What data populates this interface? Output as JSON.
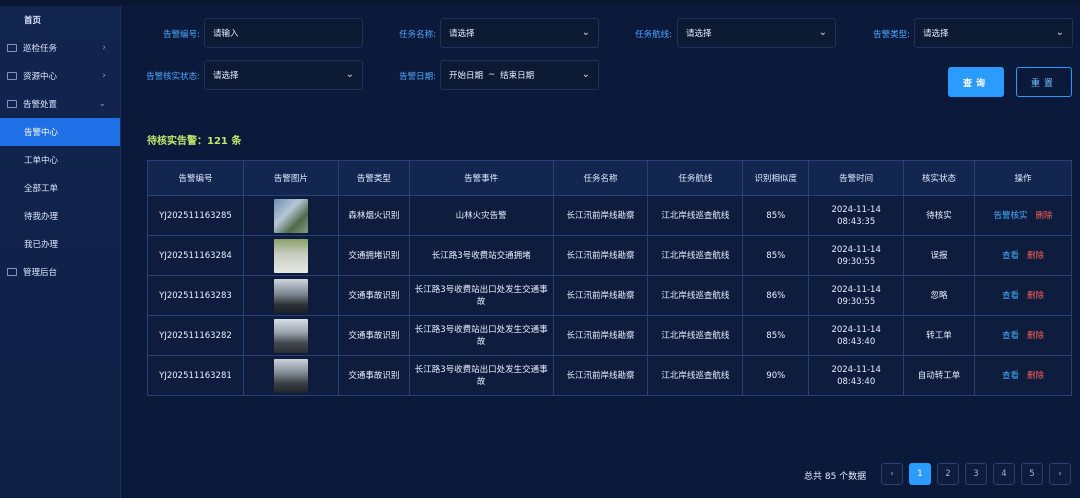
{
  "sidebar": {
    "items": [
      {
        "label": "首页",
        "kind": "home"
      },
      {
        "label": "巡检任务",
        "kind": "group",
        "chevron": "›"
      },
      {
        "label": "资源中心",
        "kind": "group",
        "chevron": "›"
      },
      {
        "label": "告警处置",
        "kind": "group",
        "chevron": "⌄"
      },
      {
        "label": "告警中心",
        "kind": "sub-active"
      },
      {
        "label": "工单中心",
        "kind": "sub"
      },
      {
        "label": "全部工单",
        "kind": "sub"
      },
      {
        "label": "待我办理",
        "kind": "sub"
      },
      {
        "label": "我已办理",
        "kind": "sub"
      },
      {
        "label": "管理后台",
        "kind": "group"
      }
    ]
  },
  "filters": {
    "alarm_no": {
      "label": "告警编号:",
      "placeholder": "请输入"
    },
    "task_name": {
      "label": "任务名称:",
      "value": "请选择"
    },
    "task_route": {
      "label": "任务航线:",
      "value": "请选择"
    },
    "alarm_type": {
      "label": "告警类型:",
      "value": "请选择"
    },
    "verify_status": {
      "label": "告警核实状态:",
      "value": "请选择"
    },
    "alarm_date": {
      "label": "告警日期:",
      "start": "开始日期",
      "sep": "~",
      "end": "结束日期"
    },
    "query_label": "查询",
    "reset_label": "重置"
  },
  "pending": "待核实告警：121 条",
  "table": {
    "headers": [
      "告警编号",
      "告警图片",
      "告警类型",
      "告警事件",
      "任务名称",
      "任务航线",
      "识别相似度",
      "告警时间",
      "核实状态",
      "操作"
    ],
    "rows": [
      {
        "id": "YJ202511163285",
        "type": "森林烟火识别",
        "event": "山林火灾告警",
        "task": "长江汛前岸线勘察",
        "route": "江北岸线巡查航线",
        "sim": "85%",
        "time": "2024-11-14 08:43:35",
        "status": "待核实",
        "status_color": "#ff5a5a",
        "op1": "告警核实",
        "op2": "删除"
      },
      {
        "id": "YJ202511163284",
        "type": "交通拥堵识别",
        "event": "长江路3号收费站交通拥堵",
        "task": "长江汛前岸线勘察",
        "route": "江北岸线巡查航线",
        "sim": "85%",
        "time": "2024-11-14 09:30:55",
        "status": "误报",
        "status_color": "#38a8ff",
        "op1": "查看",
        "op2": "删除"
      },
      {
        "id": "YJ202511163283",
        "type": "交通事故识别",
        "event": "长江路3号收费站出口处发生交通事故",
        "task": "长江汛前岸线勘察",
        "route": "江北岸线巡查航线",
        "sim": "86%",
        "time": "2024-11-14 09:30:55",
        "status": "忽略",
        "status_color": "#b38bff",
        "op1": "查看",
        "op2": "删除"
      },
      {
        "id": "YJ202511163282",
        "type": "交通事故识别",
        "event": "长江路3号收费站出口处发生交通事故",
        "task": "长江汛前岸线勘察",
        "route": "江北岸线巡查航线",
        "sim": "85%",
        "time": "2024-11-14 08:43:40",
        "status": "转工单",
        "status_color": "#34d6b2",
        "op1": "查看",
        "op2": "删除"
      },
      {
        "id": "YJ202511163281",
        "type": "交通事故识别",
        "event": "长江路3号收费站出口处发生交通事故",
        "task": "长江汛前岸线勘察",
        "route": "江北岸线巡查航线",
        "sim": "90%",
        "time": "2024-11-14 08:43:40",
        "status": "自动转工单",
        "status_color": "#34d6b2",
        "op1": "查看",
        "op2": "删除"
      }
    ]
  },
  "pagination": {
    "total": "总共 85 个数据",
    "prev": "‹",
    "next": "›",
    "pages": [
      "1",
      "2",
      "3",
      "4",
      "5"
    ],
    "current": "1"
  }
}
